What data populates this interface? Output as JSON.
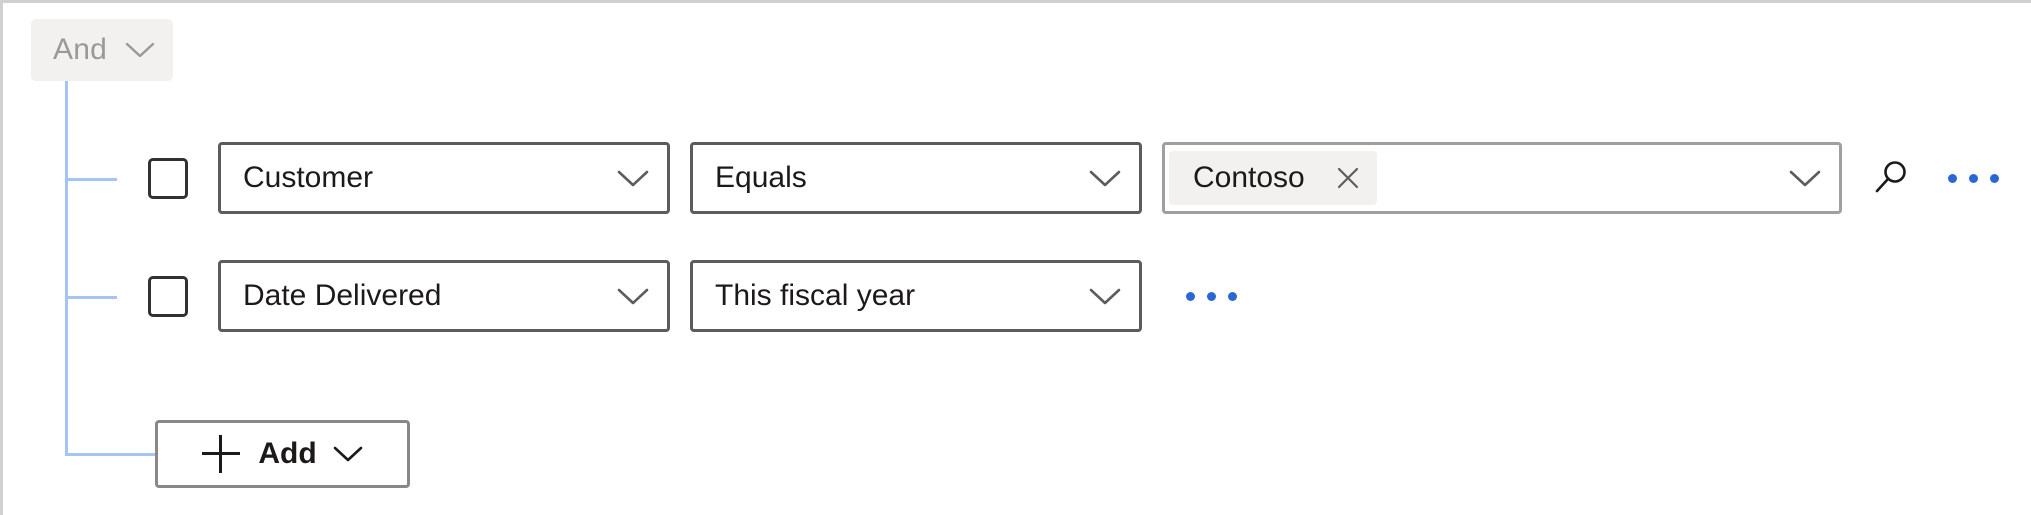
{
  "panel": {
    "group_operator": {
      "label": "And",
      "chevron_icon": "chevron-down-icon"
    }
  },
  "conditions": [
    {
      "checkbox_checked": false,
      "column": {
        "value": "Customer",
        "chevron_icon": "chevron-down-icon"
      },
      "operator": {
        "value": "Equals",
        "chevron_icon": "chevron-down-icon"
      },
      "value_field": {
        "tokens": [
          {
            "label": "Contoso",
            "remove_icon": "close-icon"
          }
        ],
        "placeholder": "",
        "chevron_icon": "chevron-down-icon"
      },
      "search_icon": "search-icon",
      "overflow_label": "more-options-icon"
    },
    {
      "checkbox_checked": false,
      "column": {
        "value": "Date Delivered",
        "chevron_icon": "chevron-down-icon"
      },
      "operator": {
        "value": "This fiscal year",
        "chevron_icon": "chevron-down-icon"
      },
      "overflow_label": "more-options-icon"
    }
  ],
  "add_button": {
    "label": "Add",
    "plus_icon": "plus-icon",
    "chevron_icon": "chevron-down-icon"
  },
  "colors": {
    "connector_line": "#a4c4f4",
    "accent_blue": "#2a67d4",
    "token_background": "#f2f1f0",
    "group_pill_background": "#f2f1f0",
    "group_pill_text": "#9a9996",
    "field_border": "#5e5c5a",
    "value_field_border": "#a19f9d",
    "panel_border": "#d2d0ce",
    "text_primary": "#1b1a19"
  }
}
